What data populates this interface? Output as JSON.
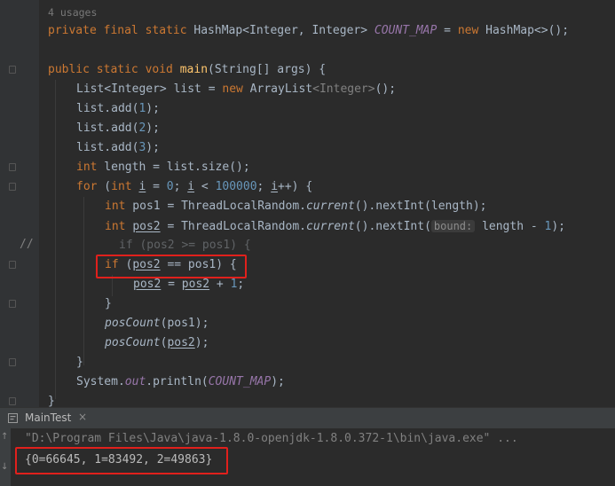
{
  "editor": {
    "usages_hint": "4 usages",
    "gutter_comment_marker": "//",
    "field_line": {
      "kw1": "private",
      "kw2": "final",
      "kw3": "static",
      "type": "HashMap<Integer, Integer>",
      "name": "COUNT_MAP",
      "eq": "=",
      "kw_new": "new",
      "ctor": "HashMap<>();"
    },
    "lines": {
      "main_sig": {
        "kw": "public static void",
        "name": "main",
        "rest": "(String[] args) {"
      },
      "list_decl": {
        "type": "List<Integer>",
        "mid": " list = ",
        "kw_new": "new",
        "ctor_a": " ArrayList",
        "ctor_gen": "<Integer>",
        "ctor_b": "();"
      },
      "add1": {
        "pre": "list.add(",
        "num": "1",
        "post": ");"
      },
      "add2": {
        "pre": "list.add(",
        "num": "2",
        "post": ");"
      },
      "add3": {
        "pre": "list.add(",
        "num": "3",
        "post": ");"
      },
      "length_decl": {
        "kw": "int",
        "rest": " length = list.size();"
      },
      "for_loop": {
        "kw_for": "for",
        "p1": " (",
        "kw_int": "int",
        "var": "i",
        "p2": " = ",
        "n0": "0",
        "p3": "; ",
        "var2": "i",
        "p4": " < ",
        "n1": "100000",
        "p5": "; ",
        "var3": "i",
        "p6": "++) {"
      },
      "pos1_decl": {
        "kw": "int",
        "p1": " pos1 = ThreadLocalRandom.",
        "meth": "current",
        "p2": "().nextInt(length);"
      },
      "pos2_decl": {
        "kw": "int",
        "var": "pos2",
        "p1": " = ThreadLocalRandom.",
        "meth": "current",
        "p2": "().nextInt(",
        "inlay": "bound:",
        "p3": " length - ",
        "num": "1",
        "p4": ");"
      },
      "commented_if": {
        "text": "if (pos2 >= pos1) {"
      },
      "if_line": {
        "kw": "if",
        "p1": " (",
        "var": "pos2",
        "p2": " == pos1) {"
      },
      "incr_line": {
        "var": "pos2",
        "p1": " = ",
        "var2": "pos2",
        "p2": " + ",
        "num": "1",
        "p3": ";"
      },
      "close_if": {
        "text": "}"
      },
      "poscount1": {
        "meth": "posCount",
        "rest": "(pos1);"
      },
      "poscount2": {
        "meth": "posCount",
        "p1": "(",
        "var": "pos2",
        "p2": ");"
      },
      "close_for": {
        "text": "}"
      },
      "println": {
        "p1": "System.",
        "fld": "out",
        "p2": ".println(",
        "fld2": "COUNT_MAP",
        "p3": ");"
      },
      "close_main": {
        "text": "}"
      }
    }
  },
  "run_panel": {
    "tab_label": "MainTest",
    "tab_close": "×",
    "command_line": "\"D:\\Program Files\\Java\\java-1.8.0-openjdk-1.8.0.372-1\\bin\\java.exe\" ...",
    "output_line": "{0=66645, 1=83492, 2=49863}"
  },
  "colors": {
    "background": "#2b2b2b",
    "keyword": "#cc7832",
    "field": "#9876aa",
    "number": "#6897bb",
    "highlight_box": "#e0201c"
  }
}
